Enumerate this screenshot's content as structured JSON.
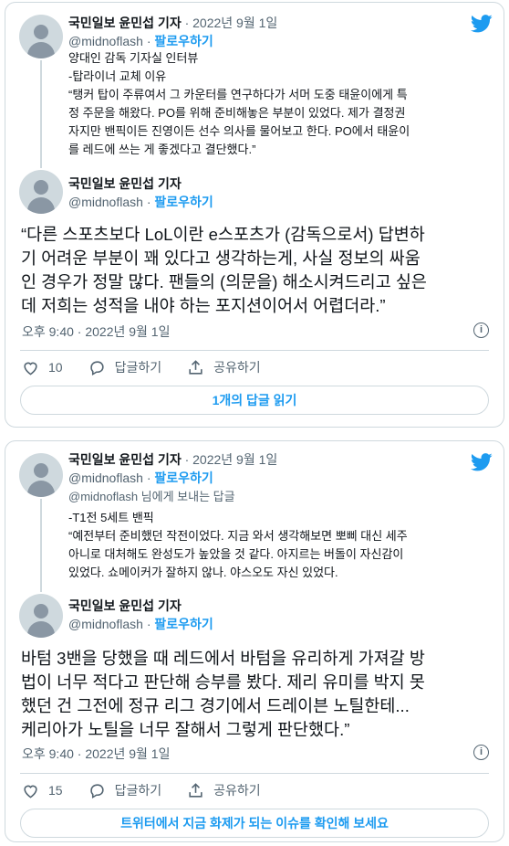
{
  "colors": {
    "accent": "#1d9bf0",
    "muted": "#536471",
    "border": "#cfd9de"
  },
  "cards": [
    {
      "quoted": {
        "author": "국민일보 윤민섭 기자",
        "date": "· 2022년 9월 1일",
        "handle": "@midnoflash",
        "follow": "팔로우하기",
        "lines": [
          "양대인 감독 기자실 인터뷰",
          "-탑라이너 교체 이유",
          "“탱커 탑이 주류여서 그 카운터를 연구하다가 서머 도중 태윤이에게 특",
          "정 주문을 해왔다. PO를 위해 준비해놓은 부분이 있었다. 제가 결정권",
          "자지만 밴픽이든 진영이든 선수 의사를 물어보고 한다. PO에서 태윤이",
          "를 레드에 쓰는 게 좋겠다고 결단했다.”"
        ]
      },
      "tweet": {
        "author": "국민일보 윤민섭 기자",
        "handle": "@midnoflash",
        "follow": "팔로우하기",
        "lines": [
          "“다른 스포츠보다 LoL이란 e스포츠가 (감독으로서) 답변하",
          "기 어려운 부분이 꽤 있다고 생각하는게, 사실 정보의 싸움",
          "인 경우가 정말 많다. 팬들의 (의문을) 해소시켜드리고 싶은",
          "데 저희는 성적을 내야 하는 포지션이어서 어렵더라.”"
        ],
        "time": "오후 9:40 · 2022년 9월 1일",
        "likes": "10",
        "reply_label": "답글하기",
        "share_label": "공유하기",
        "bottom_button": "1개의 답글 읽기"
      }
    },
    {
      "quoted": {
        "author": "국민일보 윤민섭 기자",
        "date": "· 2022년 9월 1일",
        "handle": "@midnoflash",
        "follow": "팔로우하기",
        "reply_to": "@midnoflash 님에게 보내는 답글",
        "lines": [
          "-T1전 5세트 밴픽",
          "“예전부터 준비했던 작전이었다. 지금 와서 생각해보면 뽀삐 대신 세주",
          "아니로 대처해도 완성도가 높았을 것 같다. 아지르는 버돌이 자신감이",
          "있었다. 쇼메이커가 잘하지 않나. 야스오도 자신 있었다."
        ]
      },
      "tweet": {
        "author": "국민일보 윤민섭 기자",
        "handle": "@midnoflash",
        "follow": "팔로우하기",
        "lines": [
          "바텀 3밴을 당했을 때 레드에서 바텀을 유리하게 가져갈 방",
          "법이 너무 적다고 판단해 승부를 봤다. 제리 유미를 박지 못",
          "했던 건 그전에 정규 리그 경기에서 드레이븐 노틸한테...",
          "케리아가 노틸을 너무 잘해서 그렇게 판단했다.”"
        ],
        "time": "오후 9:40 · 2022년 9월 1일",
        "likes": "15",
        "reply_label": "답글하기",
        "share_label": "공유하기",
        "bottom_button": "트위터에서 지금 화제가 되는 이슈를 확인해 보세요"
      }
    }
  ]
}
